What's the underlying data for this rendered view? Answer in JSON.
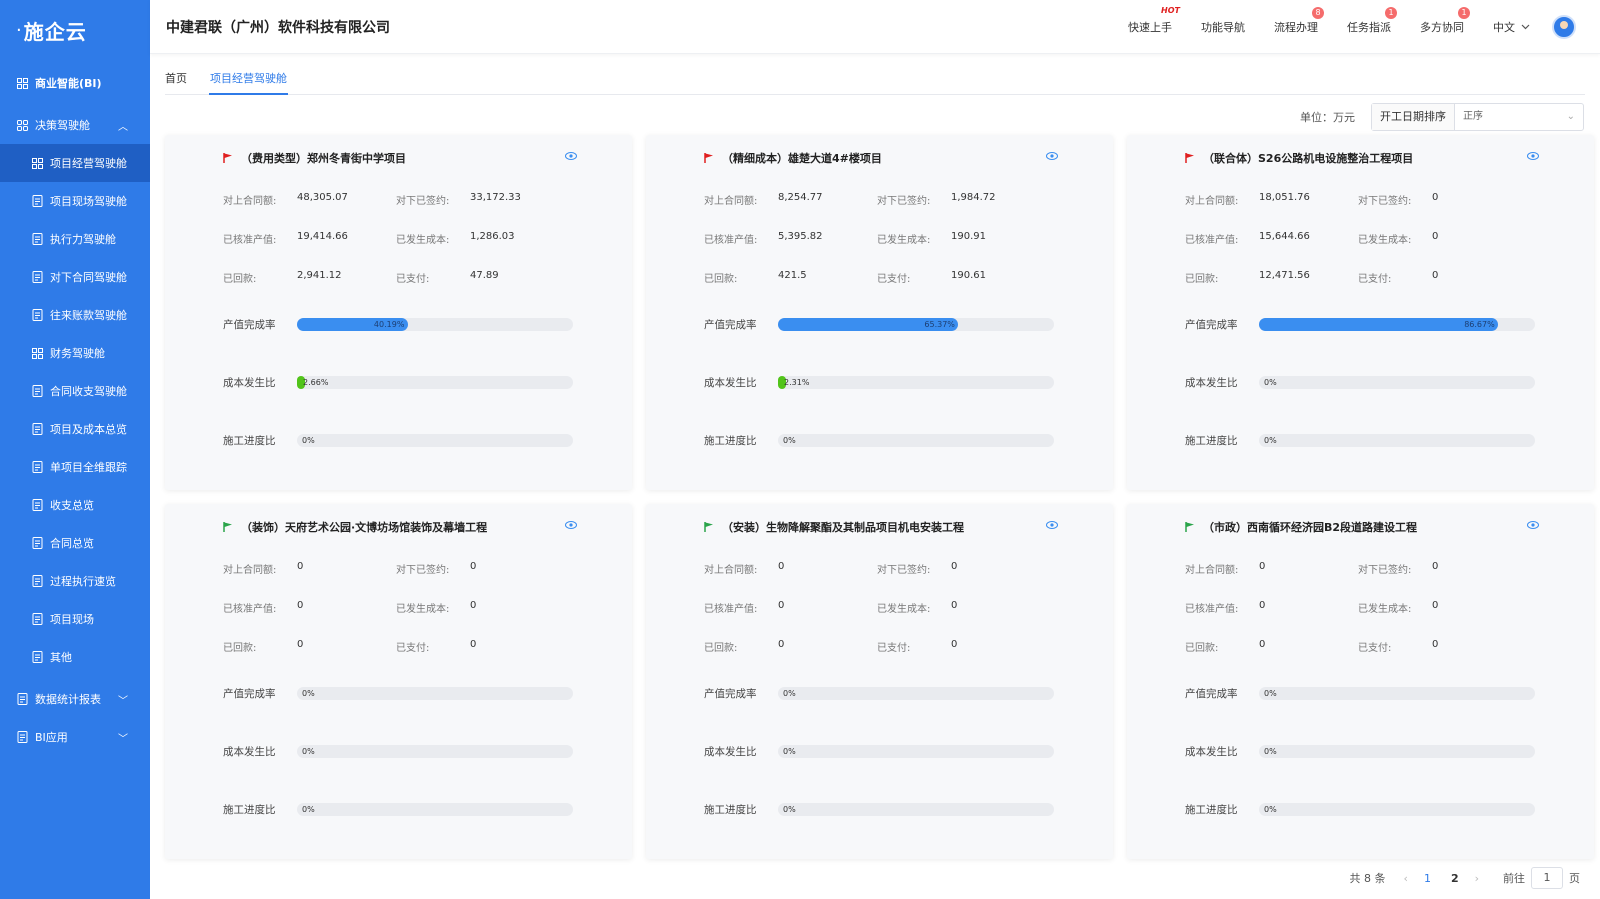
{
  "sidebar": {
    "logo": "施企云",
    "items": [
      {
        "label": "商业智能(BI)",
        "level": "top",
        "icon": "grid-icon",
        "bold": true
      },
      {
        "label": "决策驾驶舱",
        "level": "top",
        "icon": "dashboard-icon",
        "chev": "up"
      },
      {
        "label": "项目经营驾驶舱",
        "level": "sub",
        "icon": "grid-icon",
        "active": true
      },
      {
        "label": "项目现场驾驶舱",
        "level": "sub",
        "icon": "document-icon"
      },
      {
        "label": "执行力驾驶舱",
        "level": "sub",
        "icon": "calendar-check-icon"
      },
      {
        "label": "对下合同驾驶舱",
        "level": "sub",
        "icon": "contract-icon"
      },
      {
        "label": "往来账款驾驶舱",
        "level": "sub",
        "icon": "ledger-icon"
      },
      {
        "label": "财务驾驶舱",
        "level": "sub",
        "icon": "grid-icon"
      },
      {
        "label": "合同收支驾驶舱",
        "level": "sub",
        "icon": "target-icon"
      },
      {
        "label": "项目及成本总览",
        "level": "sub",
        "icon": "cost-icon"
      },
      {
        "label": "单项目全维跟踪",
        "level": "sub",
        "icon": "track-icon"
      },
      {
        "label": "收支总览",
        "level": "sub",
        "icon": "coins-icon"
      },
      {
        "label": "合同总览",
        "level": "sub",
        "icon": "contract-icon"
      },
      {
        "label": "过程执行速览",
        "level": "sub",
        "icon": "calendar-icon"
      },
      {
        "label": "项目现场",
        "level": "sub",
        "icon": "layers-icon"
      },
      {
        "label": "其他",
        "level": "sub",
        "icon": "cube-icon"
      },
      {
        "label": "数据统计报表",
        "level": "top",
        "icon": "report-icon",
        "chev": "down"
      },
      {
        "label": "BI应用",
        "level": "top",
        "icon": "app-icon",
        "chev": "down"
      }
    ]
  },
  "header": {
    "company": "中建君联（广州）软件科技有限公司",
    "nav": [
      {
        "label": "快速上手",
        "hot": "HOT"
      },
      {
        "label": "功能导航"
      },
      {
        "label": "流程办理",
        "badge": "8"
      },
      {
        "label": "任务指派",
        "badge": "1"
      },
      {
        "label": "多方协同",
        "badge": "1"
      }
    ],
    "lang": "中文"
  },
  "tabs": [
    {
      "label": "首页",
      "active": false
    },
    {
      "label": "项目经营驾驶舱",
      "active": true
    }
  ],
  "toolbar": {
    "unit": "单位：万元",
    "sort_label": "开工日期排序",
    "sort_value": "正序"
  },
  "labels": {
    "contract_up": "对上合同额:",
    "contract_down": "对下已签约:",
    "approved_output": "已核准产值:",
    "cost_incurred": "已发生成本:",
    "received": "已回款:",
    "paid": "已支付:",
    "output_rate": "产值完成率",
    "cost_ratio": "成本发生比",
    "progress_ratio": "施工进度比"
  },
  "cards": [
    {
      "title": "（费用类型）郑州冬青街中学项目",
      "flag": "#e02020",
      "contract_up": "48,305.07",
      "contract_down": "33,172.33",
      "approved_output": "19,414.66",
      "cost_incurred": "1,286.03",
      "received": "2,941.12",
      "paid": "47.89",
      "output_rate": {
        "value": 40.19,
        "text": "40.19%"
      },
      "cost_ratio": {
        "value": 2.66,
        "text": "2.66%"
      },
      "progress_ratio": {
        "value": 0,
        "text": "0%"
      }
    },
    {
      "title": "（精细成本）雄楚大道4#楼项目",
      "flag": "#e02020",
      "contract_up": "8,254.77",
      "contract_down": "1,984.72",
      "approved_output": "5,395.82",
      "cost_incurred": "190.91",
      "received": "421.5",
      "paid": "190.61",
      "output_rate": {
        "value": 65.37,
        "text": "65.37%"
      },
      "cost_ratio": {
        "value": 2.31,
        "text": "2.31%"
      },
      "progress_ratio": {
        "value": 0,
        "text": "0%"
      }
    },
    {
      "title": "（联合体）S26公路机电设施整治工程项目",
      "flag": "#e02020",
      "contract_up": "18,051.76",
      "contract_down": "0",
      "approved_output": "15,644.66",
      "cost_incurred": "0",
      "received": "12,471.56",
      "paid": "0",
      "output_rate": {
        "value": 86.67,
        "text": "86.67%"
      },
      "cost_ratio": {
        "value": 0,
        "text": "0%"
      },
      "progress_ratio": {
        "value": 0,
        "text": "0%"
      }
    },
    {
      "title": "（装饰）天府艺术公园·文博坊场馆装饰及幕墙工程",
      "flag": "#2aa44a",
      "contract_up": "0",
      "contract_down": "0",
      "approved_output": "0",
      "cost_incurred": "0",
      "received": "0",
      "paid": "0",
      "output_rate": {
        "value": 0,
        "text": "0%"
      },
      "cost_ratio": {
        "value": 0,
        "text": "0%"
      },
      "progress_ratio": {
        "value": 0,
        "text": "0%"
      }
    },
    {
      "title": "（安装）生物降解聚酯及其制品项目机电安装工程",
      "flag": "#2aa44a",
      "contract_up": "0",
      "contract_down": "0",
      "approved_output": "0",
      "cost_incurred": "0",
      "received": "0",
      "paid": "0",
      "output_rate": {
        "value": 0,
        "text": "0%"
      },
      "cost_ratio": {
        "value": 0,
        "text": "0%"
      },
      "progress_ratio": {
        "value": 0,
        "text": "0%"
      }
    },
    {
      "title": "（市政）西南循环经济园B2段道路建设工程",
      "flag": "#2aa44a",
      "contract_up": "0",
      "contract_down": "0",
      "approved_output": "0",
      "cost_incurred": "0",
      "received": "0",
      "paid": "0",
      "output_rate": {
        "value": 0,
        "text": "0%"
      },
      "cost_ratio": {
        "value": 0,
        "text": "0%"
      },
      "progress_ratio": {
        "value": 0,
        "text": "0%"
      }
    }
  ],
  "pager": {
    "total": "共 8 条",
    "pages": [
      "1",
      "2"
    ],
    "current": "1",
    "goto_label": "前往",
    "goto_value": "1",
    "page_suffix": "页"
  },
  "colors": {
    "sidebar": "#2f7be8",
    "accent": "#2f7be8",
    "bar_blue": "#3a8ef0",
    "bar_green": "#52c41a",
    "flag_red": "#e02020",
    "flag_green": "#2aa44a"
  }
}
